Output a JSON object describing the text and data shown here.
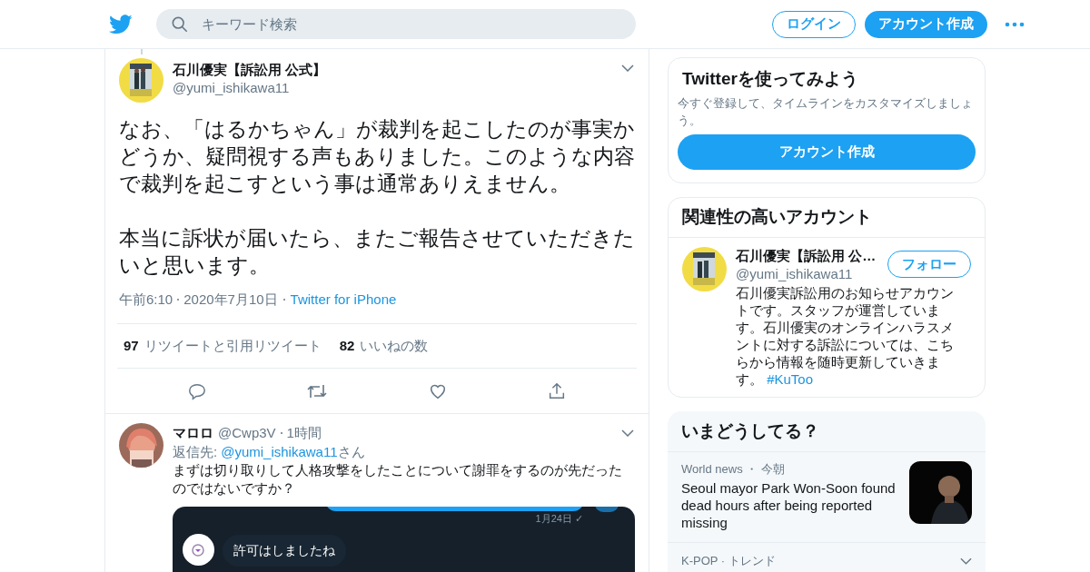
{
  "header": {
    "search": {
      "placeholder": "キーワード検索"
    },
    "login_button": "ログイン",
    "signup_button": "アカウント作成"
  },
  "tweet": {
    "name": "石川優実【訴訟用 公式】",
    "handle": "@yumi_ishikawa11",
    "paragraphs": [
      "なお、「はるかちゃん」が裁判を起こしたのが事実かどうか、疑問視する声もありました。このような内容で裁判を起こすという事は通常ありえません。",
      "本当に訴状が届いたら、またご報告させていただきたいと思います。"
    ],
    "time": "午前6:10",
    "date": "2020年7月10日",
    "source": "Twitter for iPhone",
    "stats": [
      {
        "count": "97",
        "label": "リツイートと引用リツイート"
      },
      {
        "count": "82",
        "label": "いいねの数"
      }
    ]
  },
  "reply": {
    "name": "マロロ",
    "handle": "@Cwp3V",
    "time": "1時間",
    "reply_prefix": "返信先:",
    "reply_handle": "@yumi_ishikawa11",
    "reply_suffix": "さん",
    "text": "まずは切り取りして人格攻撃をしたことについて謝罪をするのが先だったのではないですか？",
    "attachment": {
      "timestamp": "1月24日 ✓",
      "message": "許可はしましたね"
    }
  },
  "sidebar": {
    "signup_card": {
      "title": "Twitterを使ってみよう",
      "text": "今すぐ登録して、タイムラインをカスタマイズしましょう。",
      "button": "アカウント作成"
    },
    "related_card": {
      "title": "関連性の高いアカウント",
      "accounts": [
        {
          "name": "石川優実【訴訟用 公…",
          "handle": "@yumi_ishikawa11",
          "button": "フォロー",
          "bio": "石川優実訴訟用のお知らせアカウントです。スタッフが運営しています。石川優実のオンラインハラスメントに対する訴訟については、こちらから情報を随時更新していきます。",
          "hashtag": "#KuToo"
        }
      ]
    },
    "trends_card": {
      "title": "いまどうしてる？",
      "items": [
        {
          "kind": "news",
          "category": "World news ・ 今朝",
          "headline": "Seoul mayor Park Won-Soon found dead hours after being reported missing"
        },
        {
          "kind": "trend",
          "category": "K-POP · トレンド"
        }
      ]
    }
  }
}
